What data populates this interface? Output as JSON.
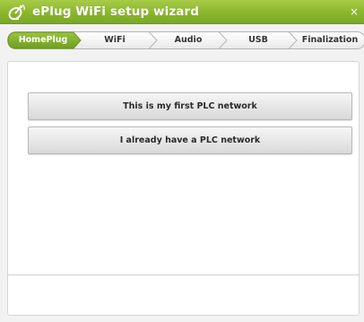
{
  "window": {
    "title": "ePlug WiFi setup wizard",
    "close_label": "×",
    "app_icon": "satellite-dish-icon"
  },
  "steps": [
    {
      "label": "HomePlug",
      "active": true
    },
    {
      "label": "WiFi",
      "active": false
    },
    {
      "label": "Audio",
      "active": false
    },
    {
      "label": "USB",
      "active": false
    },
    {
      "label": "Finalization",
      "active": false
    }
  ],
  "choices": {
    "first_network": "This is my first PLC network",
    "existing_network": "I already have a PLC network"
  },
  "colors": {
    "accent": "#8cb82e",
    "active_step": "#7fae2b"
  }
}
